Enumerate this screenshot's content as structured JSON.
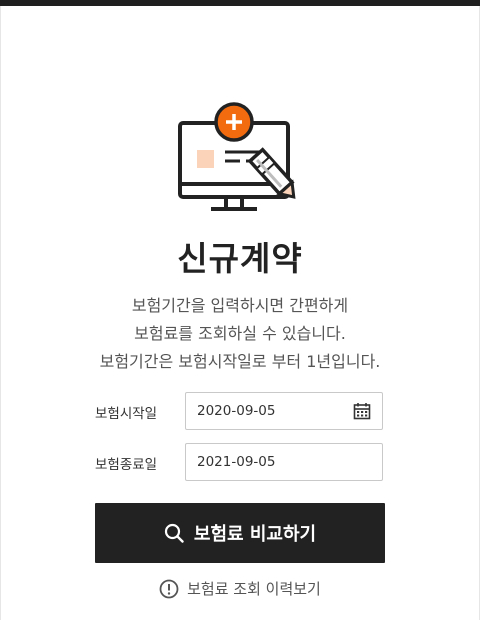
{
  "card": {
    "title": "신규계약",
    "description_lines": [
      "보험기간을 입력하시면 간편하게",
      "보험료를 조회하실 수 있습니다.",
      "보험기간은 보험시작일로 부터 1년입니다."
    ]
  },
  "form": {
    "start_label": "보험시작일",
    "start_value": "2020-09-05",
    "end_label": "보험종료일",
    "end_value": "2021-09-05"
  },
  "actions": {
    "compare_label": "보험료 비교하기",
    "history_label": "보험료 조회 이력보기"
  },
  "icons": {
    "hero": "monitor-with-plus-and-pen-icon",
    "calendar": "calendar-icon",
    "search": "search-icon",
    "info": "exclamation-circle-icon"
  },
  "colors": {
    "accent": "#f26b0f",
    "dark": "#222222",
    "peach": "#fbd3b8"
  }
}
